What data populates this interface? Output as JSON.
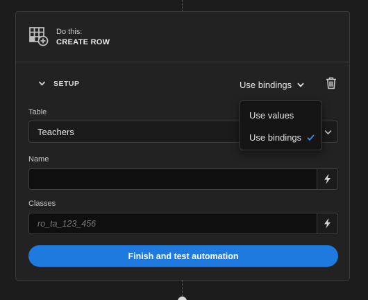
{
  "step": {
    "do_this_label": "Do this:",
    "action_name": "CREATE ROW",
    "icon": "table-plus-icon"
  },
  "setup": {
    "label": "SETUP",
    "bindings_mode": "Use bindings",
    "delete_icon": "trash-icon"
  },
  "fields": {
    "table": {
      "label": "Table",
      "value": "Teachers"
    },
    "name": {
      "label": "Name",
      "value": "",
      "placeholder": ""
    },
    "classes": {
      "label": "Classes",
      "value": "",
      "placeholder": "ro_ta_123_456"
    }
  },
  "dropdown": {
    "options": [
      {
        "label": "Use values",
        "selected": false
      },
      {
        "label": "Use bindings",
        "selected": true
      }
    ]
  },
  "actions": {
    "finish_label": "Finish and test automation"
  },
  "colors": {
    "accent": "#1f7ae0",
    "check": "#3b8eea"
  }
}
